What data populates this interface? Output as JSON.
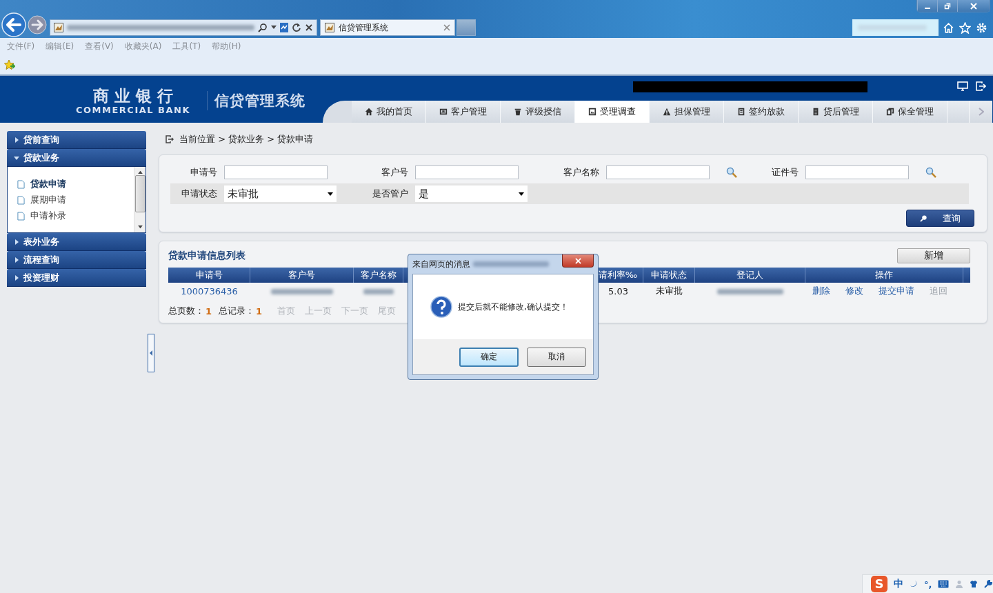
{
  "browser": {
    "tab_title": "信贷管理系统",
    "menu": [
      "文件(F)",
      "编辑(E)",
      "查看(V)",
      "收藏夹(A)",
      "工具(T)",
      "帮助(H)"
    ]
  },
  "header": {
    "bank_name": "商 业 银 行",
    "bank_name_en": "COMMERCIAL BANK",
    "system_name": "信贷管理系统"
  },
  "nav_tabs": [
    {
      "label": "我的首页",
      "selected": false
    },
    {
      "label": "客户管理",
      "selected": false
    },
    {
      "label": "评级授信",
      "selected": false
    },
    {
      "label": "受理调查",
      "selected": true
    },
    {
      "label": "担保管理",
      "selected": false
    },
    {
      "label": "签约放款",
      "selected": false
    },
    {
      "label": "贷后管理",
      "selected": false
    },
    {
      "label": "保全管理",
      "selected": false
    }
  ],
  "sidebar": {
    "sections": [
      {
        "label": "贷前查询",
        "expanded": false
      },
      {
        "label": "贷款业务",
        "expanded": true,
        "children": [
          {
            "label": "贷款申请",
            "selected": true
          },
          {
            "label": "展期申请",
            "selected": false
          },
          {
            "label": "申请补录",
            "selected": false
          }
        ]
      },
      {
        "label": "表外业务",
        "expanded": false
      },
      {
        "label": "流程查询",
        "expanded": false
      },
      {
        "label": "投资理财",
        "expanded": false
      }
    ]
  },
  "breadcrumb": "当前位置 > 贷款业务 > 贷款申请",
  "search_form": {
    "rows": [
      {
        "fields": [
          {
            "label": "申请号",
            "kind": "text"
          },
          {
            "label": "客户号",
            "kind": "text"
          },
          {
            "label": "客户名称",
            "kind": "lookup"
          },
          {
            "label": "证件号",
            "kind": "lookup"
          }
        ]
      },
      {
        "fields": [
          {
            "label": "申请状态",
            "kind": "select",
            "value": "未审批"
          },
          {
            "label": "是否管户",
            "kind": "select",
            "value": "是"
          }
        ]
      }
    ],
    "search_button": "查询"
  },
  "list": {
    "title": "贷款申请信息列表",
    "add_button": "新增",
    "columns": [
      "申请号",
      "客户号",
      "客户名称",
      "请利率‰",
      "申请状态",
      "登记人",
      "操作"
    ],
    "rows": [
      {
        "cells": [
          {
            "kind": "text",
            "text": "1000736436"
          },
          {
            "kind": "blurred"
          },
          {
            "kind": "blurred"
          },
          {
            "kind": "text",
            "text": "5.03"
          },
          {
            "kind": "text",
            "text": "未审批"
          },
          {
            "kind": "blurred"
          }
        ],
        "actions": [
          {
            "label": "删除",
            "disabled": false
          },
          {
            "label": "修改",
            "disabled": false
          },
          {
            "label": "提交申请",
            "disabled": false
          },
          {
            "label": "追回",
            "disabled": true
          }
        ]
      }
    ],
    "pagination": {
      "pages_label": "总页数：",
      "pages": "1",
      "records_label": "总记录：",
      "records": "1",
      "links": [
        {
          "label": "首页",
          "disabled": true
        },
        {
          "label": "上一页",
          "disabled": true
        },
        {
          "label": "下一页",
          "disabled": true
        },
        {
          "label": "尾页",
          "disabled": true
        }
      ]
    }
  },
  "dialog": {
    "title": "来自网页的消息",
    "message": "提交后就不能修改,确认提交！",
    "buttons": [
      {
        "label": "确定",
        "selected": true
      },
      {
        "label": "取消",
        "selected": false
      }
    ]
  },
  "ime": {
    "logo": "S",
    "mode": "中",
    "punctuation": "°,"
  }
}
